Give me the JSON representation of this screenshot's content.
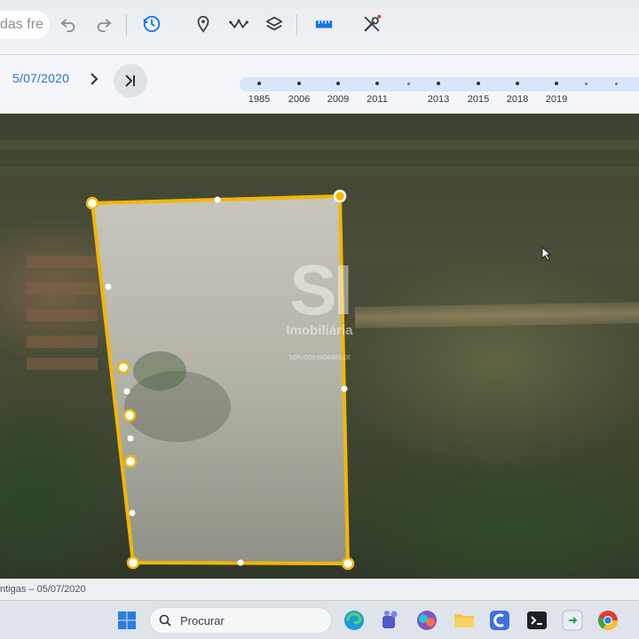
{
  "toolbar": {
    "search_stub_text": "das fre",
    "buttons": [
      {
        "name": "undo-icon"
      },
      {
        "name": "redo-icon"
      },
      {
        "name": "historical-imagery-icon"
      },
      {
        "name": "add-placemark-icon"
      },
      {
        "name": "add-path-icon"
      },
      {
        "name": "layers-icon"
      },
      {
        "name": "measure-ruler-icon"
      },
      {
        "name": "tools-icon"
      }
    ],
    "accent": "#1a73e8",
    "alert_dot_color": "#e53935"
  },
  "timeline": {
    "current_date": "5/07/2020",
    "years": [
      "1985",
      "2006",
      "2009",
      "2011",
      "2013",
      "2015",
      "2018",
      "2019"
    ],
    "track_color": "#d7e6fb"
  },
  "map": {
    "watermark": {
      "logo": "SI",
      "name": "Imobiliária",
      "url": "solucoesideais.pt"
    },
    "polygon_color": "#f2b705"
  },
  "status": {
    "text": "ntigas – 05/07/2020"
  },
  "taskbar": {
    "search_placeholder": "Procurar",
    "apps": [
      "edge-icon",
      "teams-icon",
      "copilot-icon",
      "file-explorer-icon",
      "clipchamp-icon",
      "terminal-icon",
      "remote-app-icon",
      "chrome-icon"
    ]
  }
}
